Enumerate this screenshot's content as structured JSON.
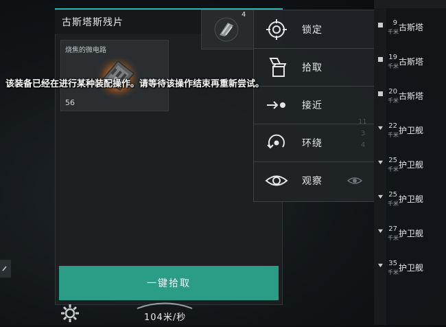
{
  "wreck": {
    "title": "古斯塔斯残片",
    "item": {
      "name": "烧焦的微电路",
      "quantity": "56",
      "icon": "circuit-icon"
    },
    "loot_all_label": "一键拾取"
  },
  "ship_button": {
    "count": "4",
    "icon": "ship-icon"
  },
  "context_menu": {
    "items": [
      {
        "label": "锁定",
        "icon": "crosshair-icon"
      },
      {
        "label": "拾取",
        "icon": "pickup-icon"
      },
      {
        "label": "接近",
        "icon": "approach-icon"
      },
      {
        "label": "环绕",
        "icon": "orbit-icon"
      },
      {
        "label": "观察",
        "icon": "eye-icon"
      }
    ]
  },
  "faded_ranges": [
    "11",
    "3",
    "4"
  ],
  "overview": {
    "unit": "千米",
    "rows": [
      {
        "distance": "9",
        "name": "古斯塔"
      },
      {
        "distance": "19",
        "name": "古斯塔"
      },
      {
        "distance": "20",
        "name": "古斯塔"
      },
      {
        "distance": "22",
        "name": "护卫舰"
      },
      {
        "distance": "25",
        "name": "护卫舰"
      },
      {
        "distance": "25",
        "name": "护卫舰"
      },
      {
        "distance": "27",
        "name": "护卫舰"
      },
      {
        "distance": "35",
        "name": "护卫舰"
      }
    ]
  },
  "warning_text": "该装备已经在进行某种装配操作。请等待该操作结束再重新尝试。",
  "speed": "104米/秒",
  "colors": {
    "accent": "#2ab6b0",
    "loot_button": "#2b9c85"
  }
}
